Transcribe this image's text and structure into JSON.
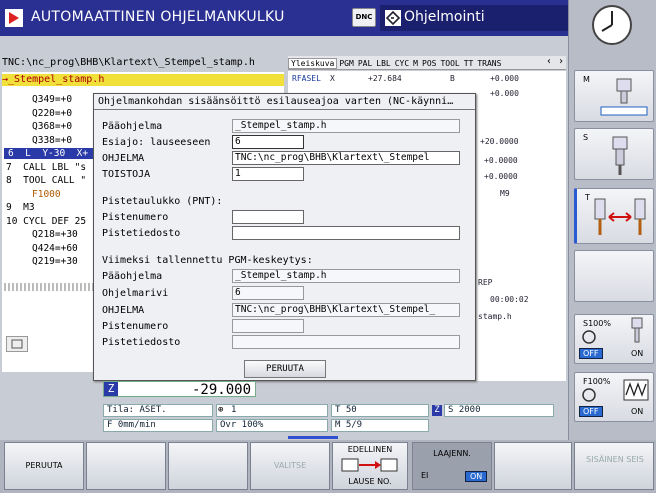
{
  "header": {
    "mode_title": "AUTOMAATTINEN OHJELMANKULKU",
    "dnc": "DNC",
    "prog_mode": "Ohjelmointi"
  },
  "program": {
    "path": "TNC:\\nc_prog\\BHB\\Klartext\\_Stempel_stamp.h",
    "file": "→_Stempel_stamp.h",
    "lines": [
      {
        "t": "Q349=+0",
        "c": "#000",
        "x": 30
      },
      {
        "t": "Q220=+0",
        "c": "#000",
        "x": 30
      },
      {
        "t": "Q368=+0",
        "c": "#000",
        "x": 30
      },
      {
        "t": "Q338=+0",
        "c": "#000",
        "x": 30
      },
      {
        "t": "6  L  Y-30  X+",
        "c": "#fff",
        "x": 4,
        "hl": true
      },
      {
        "t": "7  CALL LBL \"s",
        "c": "#000",
        "x": 4
      },
      {
        "t": "8  TOOL CALL \"",
        "c": "#000",
        "x": 4
      },
      {
        "t": "F1000",
        "c": "#b05a00",
        "x": 30
      },
      {
        "t": "9  M3",
        "c": "#000",
        "x": 4
      },
      {
        "t": "10 CYCL DEF 25",
        "c": "#000",
        "x": 4
      },
      {
        "t": "Q218=+30",
        "c": "#000",
        "x": 30
      },
      {
        "t": "Q424=+60",
        "c": "#000",
        "x": 30
      },
      {
        "t": "Q219=+30",
        "c": "#000",
        "x": 30
      }
    ]
  },
  "tabs": [
    "Yleiskuva",
    "PGM",
    "PAL",
    "LBL",
    "CYC",
    "M",
    "POS",
    "TOOL",
    "TT",
    "TRANS"
  ],
  "status": {
    "rfasel": "RFASEL",
    "rfasel_axis": "X",
    "rfasel_val": "+27.684",
    "b_axis": "B",
    "b_val": "+0.000",
    "val2": "+0.000",
    "v1": "+20.0000",
    "v2": "+0.0000",
    "v3": "+0.0000",
    "m9": "M9",
    "rep": "REP",
    "time": "00:00:02",
    "stamp": "stamp.h"
  },
  "dialog": {
    "title": "Ohjelmankohdan sisäänsöittö esilauseajoa varten (NC-käynni…",
    "paaohjelma_label": "Pääohjelma",
    "paaohjelma_val": "_Stempel_stamp.h",
    "esiajo_label": "Esiajo: lauseeseen",
    "esiajo_val": "6",
    "ohjelma_label": "OHJELMA",
    "ohjelma_val": "TNC:\\nc_prog\\BHB\\Klartext\\_Stempel",
    "toistoja_label": "TOISTOJA",
    "toistoja_val": "1",
    "pnt_head": "Pistetaulukko (PNT):",
    "pistenumero_label": "Pistenumero",
    "pistetiedosto_label": "Pistetiedosto",
    "last_head": "Viimeksi tallennettu PGM-keskeytys:",
    "last_paaohjelma_val": "_Stempel_stamp.h",
    "ohjelmarivi_label": "Ohjelmarivi",
    "ohjelmarivi_val": "6",
    "last_ohjelma_val": "TNC:\\nc_prog\\BHB\\Klartext\\_Stempel_",
    "peruuta": "PERUUTA"
  },
  "position": {
    "axis": "Z",
    "value": "-29.000"
  },
  "statusbar": {
    "tila": "Tila: ASET.",
    "tool": "1",
    "t": "T 50",
    "z": "Z",
    "s": "S 2000",
    "f": "F 0mm/min",
    "ovr": "Ovr 100%",
    "m": "M 5/9"
  },
  "softkeys": {
    "peruuta": "PERUUTA",
    "valitse": "VALITSE",
    "edellinen": "EDELLINEN",
    "lause_no": "LAUSE NO.",
    "laajenn": "LAAJENN.",
    "ei": "EI",
    "on": "ON",
    "sisainen_seis": "SISÄINEN SEIS"
  },
  "right_softkeys": {
    "m": "M",
    "s": "S",
    "t": "T",
    "s100": "S100%",
    "f100": "F100%",
    "off": "OFF",
    "on": "ON"
  }
}
